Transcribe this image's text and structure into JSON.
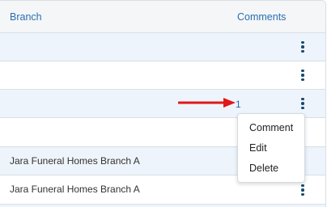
{
  "header": {
    "branch_label": "Branch",
    "comments_label": "Comments"
  },
  "rows": [
    {
      "branch": "",
      "comments": ""
    },
    {
      "branch": "",
      "comments": ""
    },
    {
      "branch": "",
      "comments": "1"
    },
    {
      "branch": "",
      "comments": ""
    },
    {
      "branch": "Jara Funeral Homes Branch A",
      "comments": ""
    },
    {
      "branch": "Jara Funeral Homes Branch A",
      "comments": ""
    }
  ],
  "context_menu": {
    "items": [
      "Comment",
      "Edit",
      "Delete"
    ]
  },
  "icons": {
    "row_actions": "kebab-menu-icon",
    "annotation": "red-arrow-icon"
  },
  "colors": {
    "accent": "#2a6fb0",
    "kebab": "#17496e",
    "row_stripe": "#eef4fb",
    "arrow": "#e01818"
  }
}
